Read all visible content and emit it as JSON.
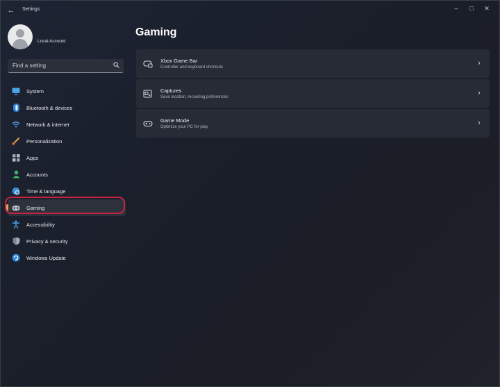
{
  "window": {
    "title": "Settings",
    "back_glyph": "←",
    "controls": {
      "minimize": "–",
      "maximize": "□",
      "close": "✕"
    }
  },
  "profile": {
    "account_name": "Local Account"
  },
  "search": {
    "placeholder": "Find a setting",
    "icon": "search-icon"
  },
  "sidebar": {
    "items": [
      {
        "label": "System",
        "icon": "monitor-icon"
      },
      {
        "label": "Bluetooth & devices",
        "icon": "bluetooth-icon"
      },
      {
        "label": "Network & internet",
        "icon": "wifi-icon"
      },
      {
        "label": "Personalization",
        "icon": "brush-icon"
      },
      {
        "label": "Apps",
        "icon": "apps-icon"
      },
      {
        "label": "Accounts",
        "icon": "person-icon"
      },
      {
        "label": "Time & language",
        "icon": "globe-icon"
      },
      {
        "label": "Gaming",
        "icon": "controller-icon",
        "selected": true
      },
      {
        "label": "Accessibility",
        "icon": "accessibility-icon"
      },
      {
        "label": "Privacy & security",
        "icon": "shield-icon"
      },
      {
        "label": "Windows Update",
        "icon": "update-icon"
      }
    ]
  },
  "main": {
    "title": "Gaming",
    "cards": [
      {
        "title": "Xbox Game Bar",
        "subtitle": "Controller and keyboard shortcuts",
        "icon": "game-bar-icon",
        "chevron": "›"
      },
      {
        "title": "Captures",
        "subtitle": "Save location, recording preferences",
        "icon": "capture-icon",
        "chevron": "›"
      },
      {
        "title": "Game Mode",
        "subtitle": "Optimize your PC for play",
        "icon": "game-mode-icon",
        "chevron": "›"
      }
    ]
  },
  "colors": {
    "accent_indicator": "#e8a04c",
    "highlight_ring": "#c8243d",
    "card_background": "#272b35"
  }
}
